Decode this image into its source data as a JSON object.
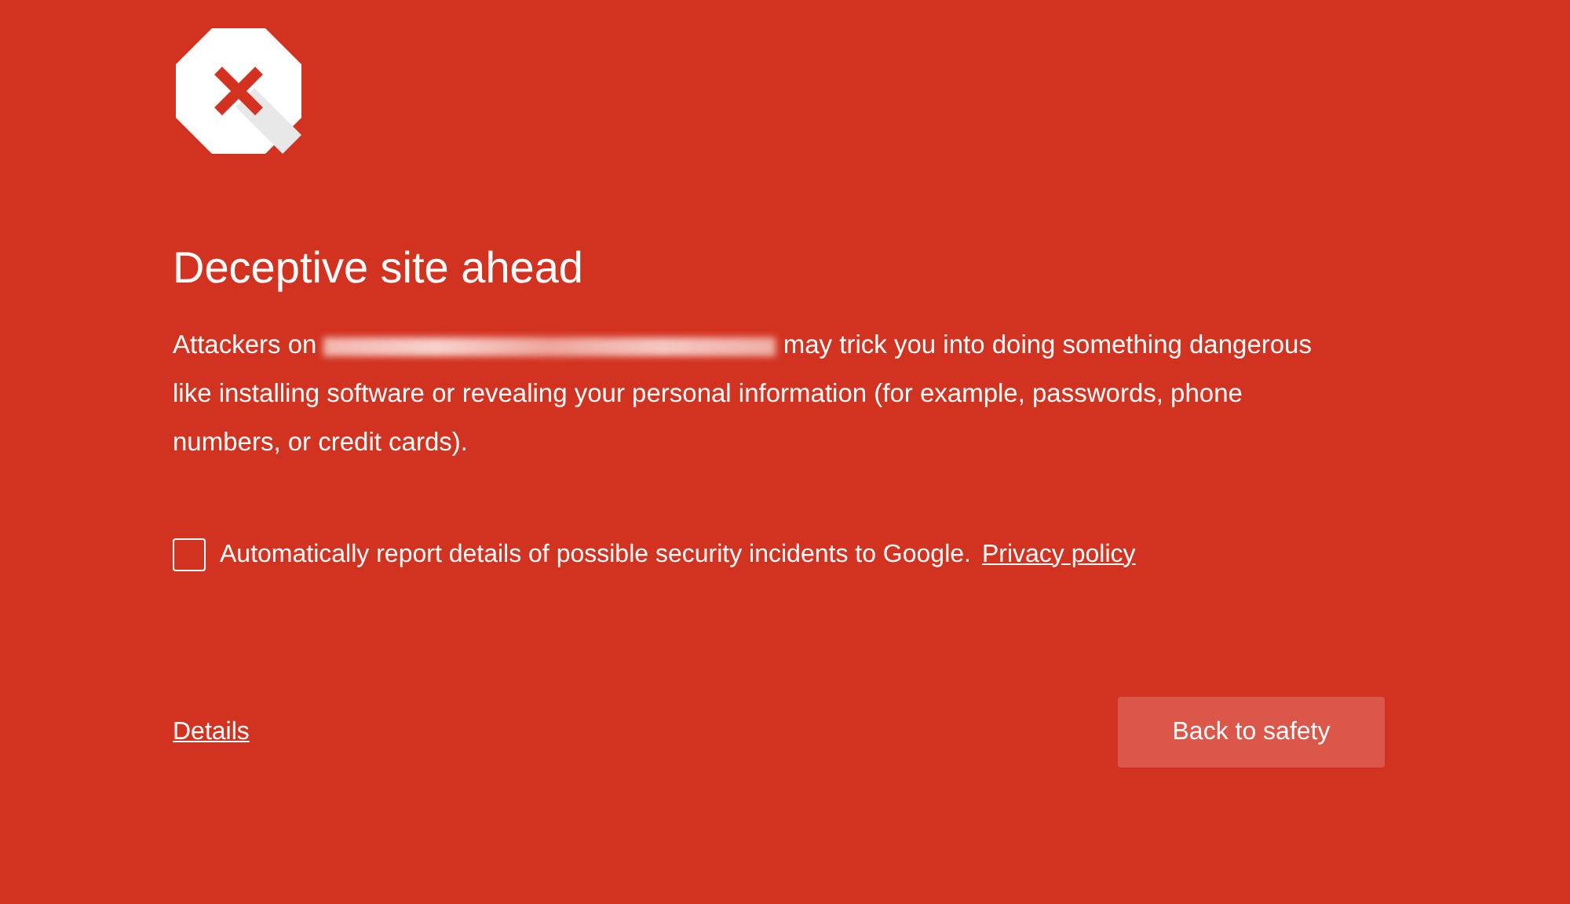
{
  "heading": "Deceptive site ahead",
  "message": {
    "before": "Attackers on",
    "after": "may trick you into doing something dangerous like installing software or revealing your personal information (for example, passwords, phone numbers, or credit cards)."
  },
  "report": {
    "checked": false,
    "label": "Automatically report details of possible security incidents to Google.",
    "link": "Privacy policy"
  },
  "details_link": "Details",
  "back_button": "Back to safety"
}
